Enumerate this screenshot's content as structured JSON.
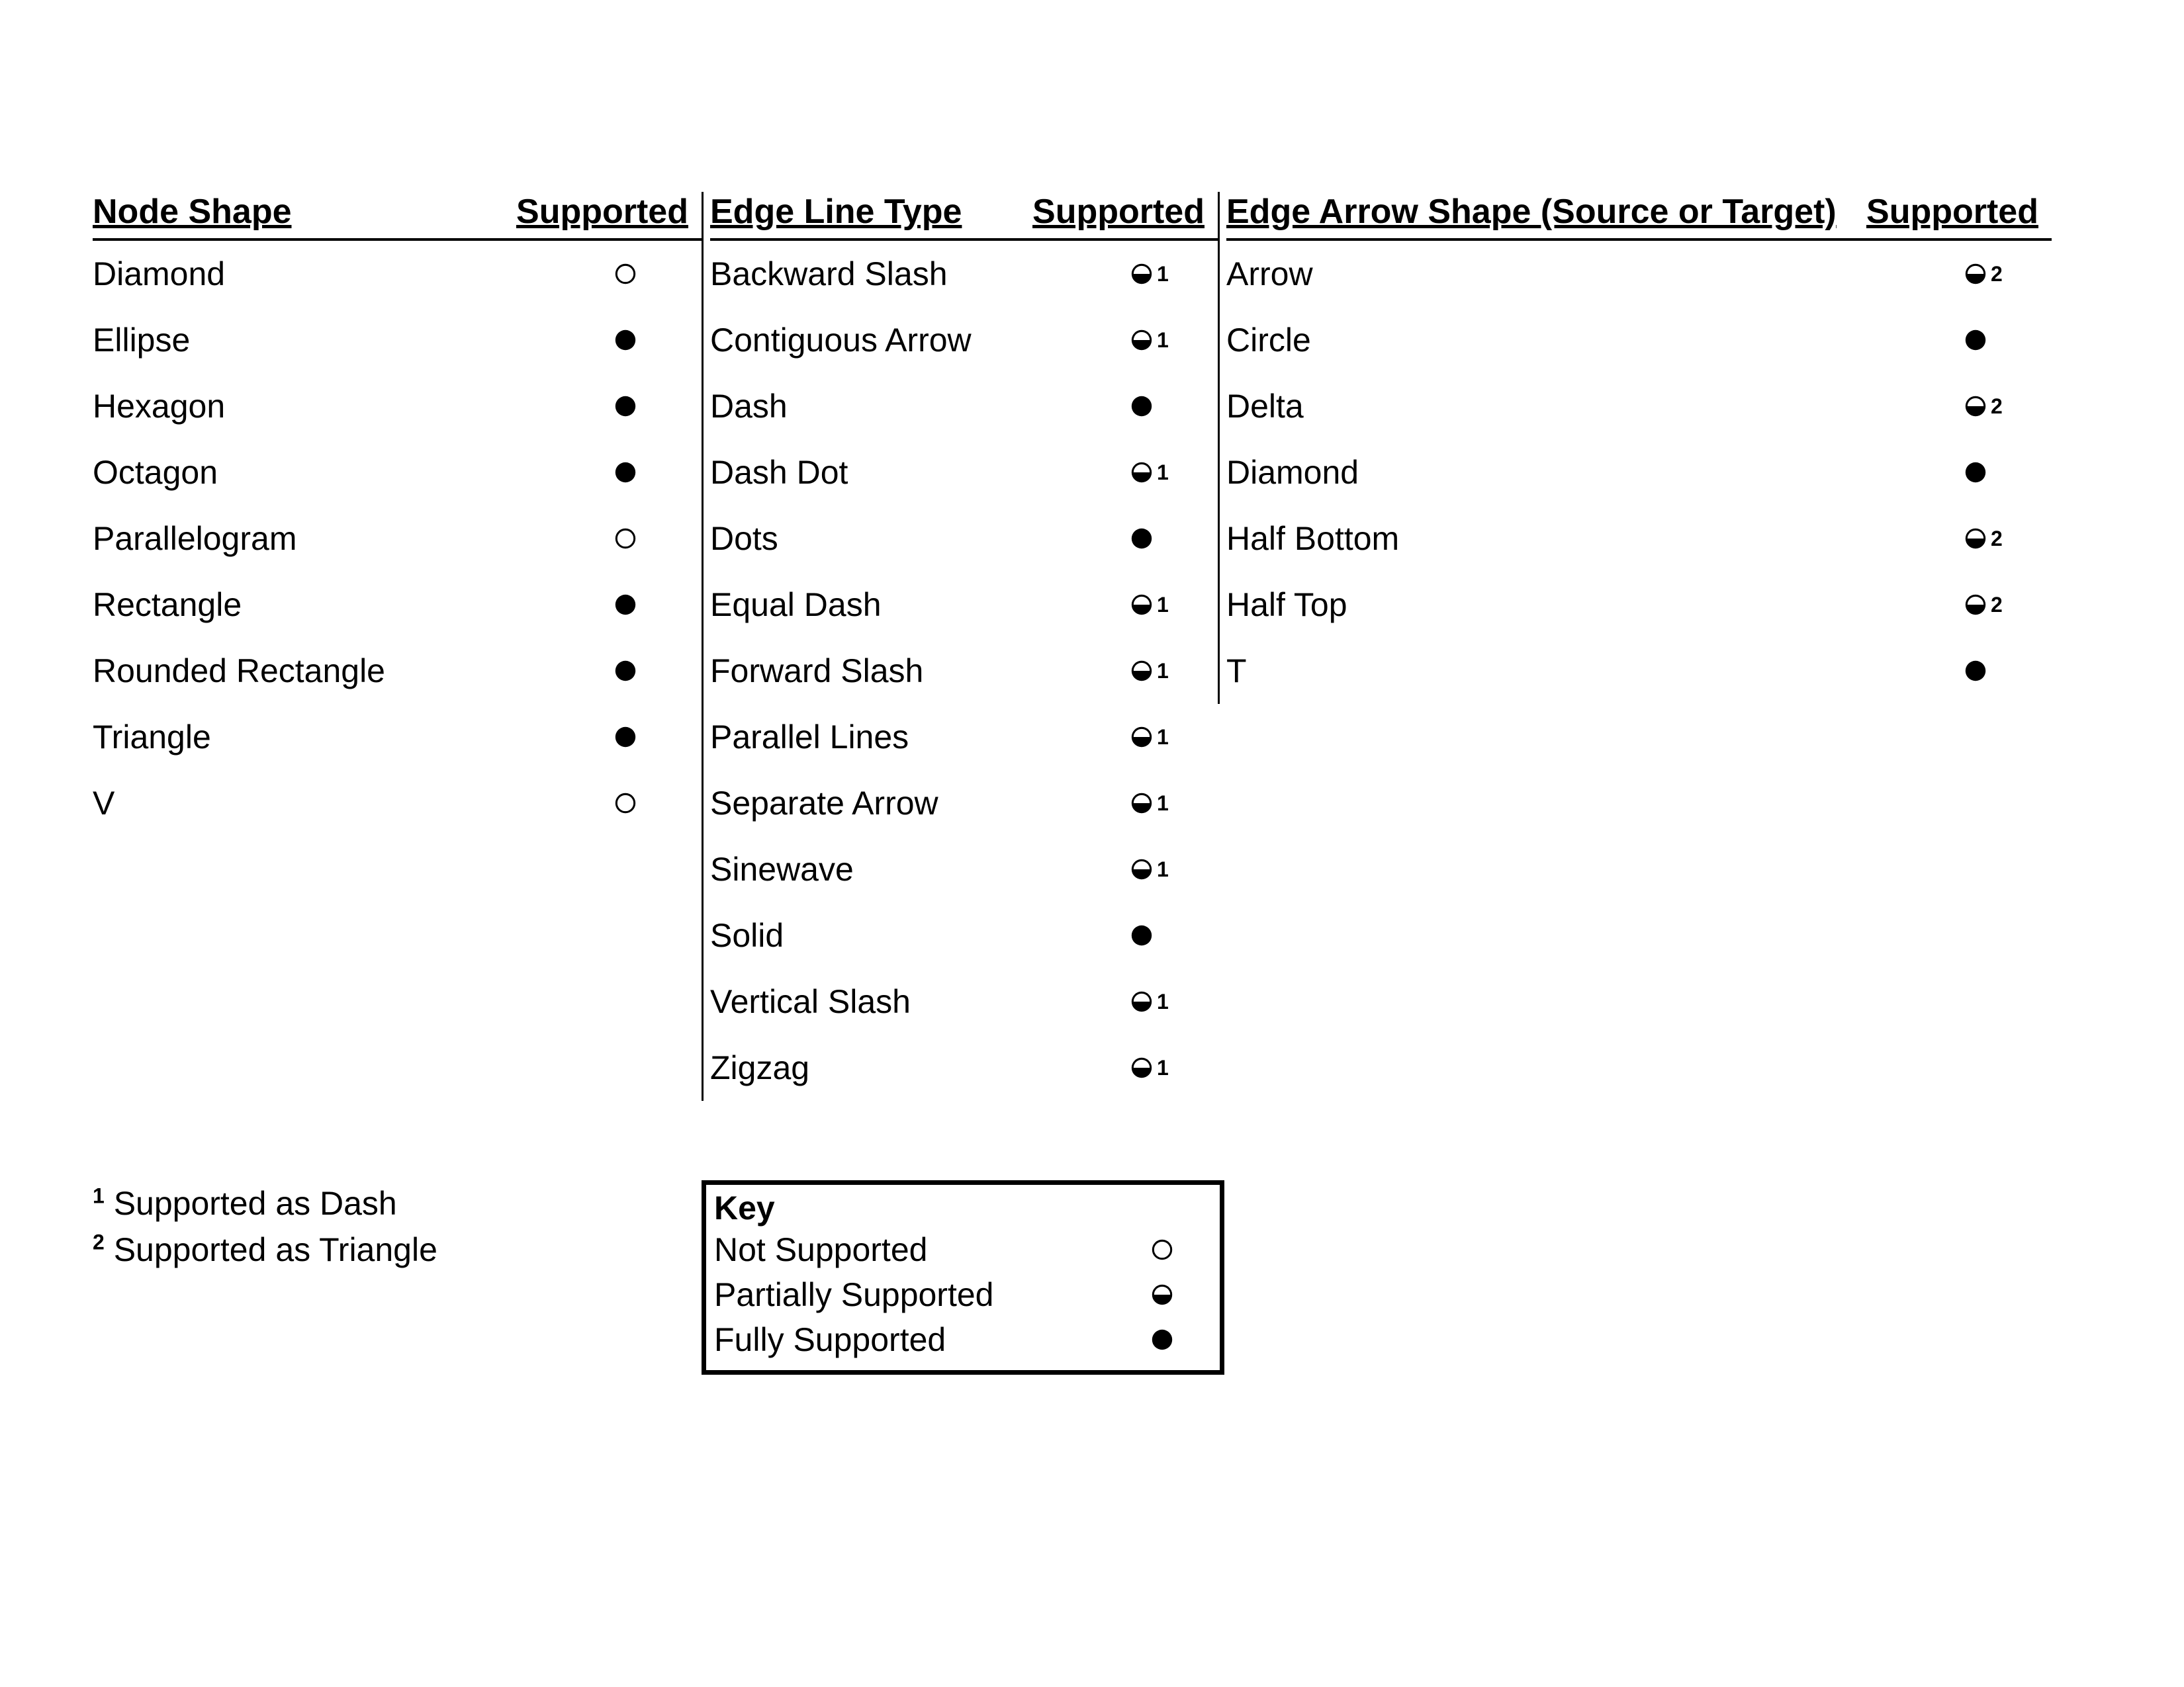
{
  "headers": {
    "node_shape": "Node Shape",
    "edge_line_type": "Edge Line Type",
    "edge_arrow_shape": "Edge Arrow Shape (Source or Target)",
    "supported": "Supported"
  },
  "columns": {
    "node_shape": [
      {
        "name": "Diamond",
        "status": "none"
      },
      {
        "name": "Ellipse",
        "status": "full"
      },
      {
        "name": "Hexagon",
        "status": "full"
      },
      {
        "name": "Octagon",
        "status": "full"
      },
      {
        "name": "Parallelogram",
        "status": "none"
      },
      {
        "name": "Rectangle",
        "status": "full"
      },
      {
        "name": "Rounded Rectangle",
        "status": "full"
      },
      {
        "name": "Triangle",
        "status": "full"
      },
      {
        "name": "V",
        "status": "none"
      }
    ],
    "edge_line_type": [
      {
        "name": "Backward Slash",
        "status": "partial",
        "note": "1"
      },
      {
        "name": "Contiguous Arrow",
        "status": "partial",
        "note": "1"
      },
      {
        "name": "Dash",
        "status": "full"
      },
      {
        "name": "Dash Dot",
        "status": "partial",
        "note": "1"
      },
      {
        "name": "Dots",
        "status": "full"
      },
      {
        "name": "Equal Dash",
        "status": "partial",
        "note": "1"
      },
      {
        "name": "Forward Slash",
        "status": "partial",
        "note": "1"
      },
      {
        "name": "Parallel Lines",
        "status": "partial",
        "note": "1"
      },
      {
        "name": "Separate Arrow",
        "status": "partial",
        "note": "1"
      },
      {
        "name": "Sinewave",
        "status": "partial",
        "note": "1"
      },
      {
        "name": "Solid",
        "status": "full"
      },
      {
        "name": "Vertical Slash",
        "status": "partial",
        "note": "1"
      },
      {
        "name": "Zigzag",
        "status": "partial",
        "note": "1"
      }
    ],
    "edge_arrow_shape": [
      {
        "name": "Arrow",
        "status": "partial",
        "note": "2"
      },
      {
        "name": "Circle",
        "status": "full"
      },
      {
        "name": "Delta",
        "status": "partial",
        "note": "2"
      },
      {
        "name": "Diamond",
        "status": "full"
      },
      {
        "name": "Half Bottom",
        "status": "partial",
        "note": "2"
      },
      {
        "name": "Half Top",
        "status": "partial",
        "note": "2"
      },
      {
        "name": "T",
        "status": "full"
      }
    ]
  },
  "footnotes": [
    {
      "marker": "1",
      "text": "Supported as Dash"
    },
    {
      "marker": "2",
      "text": "Supported as Triangle"
    }
  ],
  "key": {
    "title": "Key",
    "items": [
      {
        "label": "Not Supported",
        "status": "none"
      },
      {
        "label": "Partially Supported",
        "status": "partial"
      },
      {
        "label": "Fully Supported",
        "status": "full"
      }
    ]
  }
}
